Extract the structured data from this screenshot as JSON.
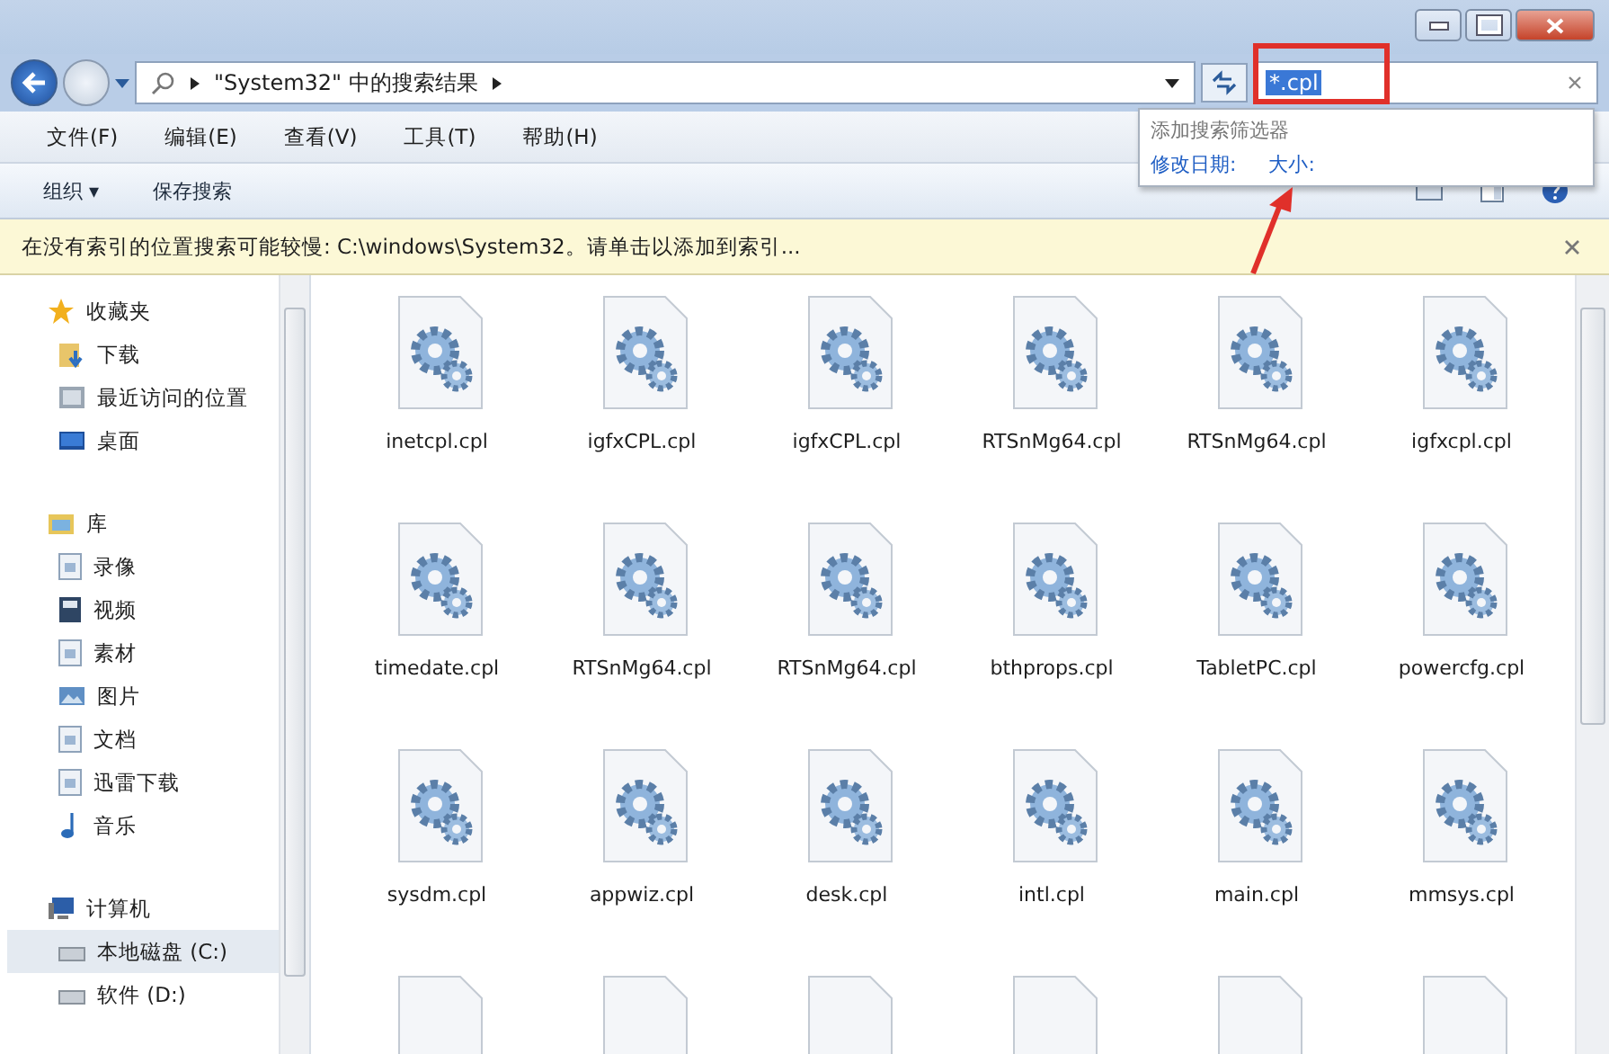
{
  "address": {
    "path": "\"System32\" 中的搜索结果"
  },
  "search": {
    "value": "*.cpl"
  },
  "search_dropdown": {
    "heading": "添加搜索筛选器",
    "filters": [
      "修改日期:",
      "大小:"
    ]
  },
  "menu": [
    "文件(F)",
    "编辑(E)",
    "查看(V)",
    "工具(T)",
    "帮助(H)"
  ],
  "toolbar": {
    "organize": "组织 ▾",
    "save_search": "保存搜索"
  },
  "info_bar": {
    "text": "在没有索引的位置搜索可能较慢: C:\\windows\\System32。请单击以添加到索引..."
  },
  "sidebar": {
    "groups": [
      {
        "label": "收藏夹",
        "kind": "star",
        "children": [
          {
            "label": "下载",
            "kind": "download",
            "selected": false
          },
          {
            "label": "最近访问的位置",
            "kind": "recent",
            "selected": false
          },
          {
            "label": "桌面",
            "kind": "desktop",
            "selected": false
          }
        ]
      },
      {
        "label": "库",
        "kind": "library",
        "children": [
          {
            "label": "录像",
            "kind": "doc",
            "selected": false
          },
          {
            "label": "视频",
            "kind": "video",
            "selected": false
          },
          {
            "label": "素材",
            "kind": "doc",
            "selected": false
          },
          {
            "label": "图片",
            "kind": "picture",
            "selected": false
          },
          {
            "label": "文档",
            "kind": "doc",
            "selected": false
          },
          {
            "label": "迅雷下载",
            "kind": "doc",
            "selected": false
          },
          {
            "label": "音乐",
            "kind": "music",
            "selected": false
          }
        ]
      },
      {
        "label": "计算机",
        "kind": "computer",
        "children": [
          {
            "label": "本地磁盘 (C:)",
            "kind": "drive",
            "selected": true
          },
          {
            "label": "软件 (D:)",
            "kind": "drive",
            "selected": false
          }
        ]
      }
    ]
  },
  "files": [
    "inetcpl.cpl",
    "igfxCPL.cpl",
    "igfxCPL.cpl",
    "RTSnMg64.cpl",
    "RTSnMg64.cpl",
    "igfxcpl.cpl",
    "timedate.cpl",
    "RTSnMg64.cpl",
    "RTSnMg64.cpl",
    "bthprops.cpl",
    "TabletPC.cpl",
    "powercfg.cpl",
    "sysdm.cpl",
    "appwiz.cpl",
    "desk.cpl",
    "intl.cpl",
    "main.cpl",
    "mmsys.cpl"
  ]
}
